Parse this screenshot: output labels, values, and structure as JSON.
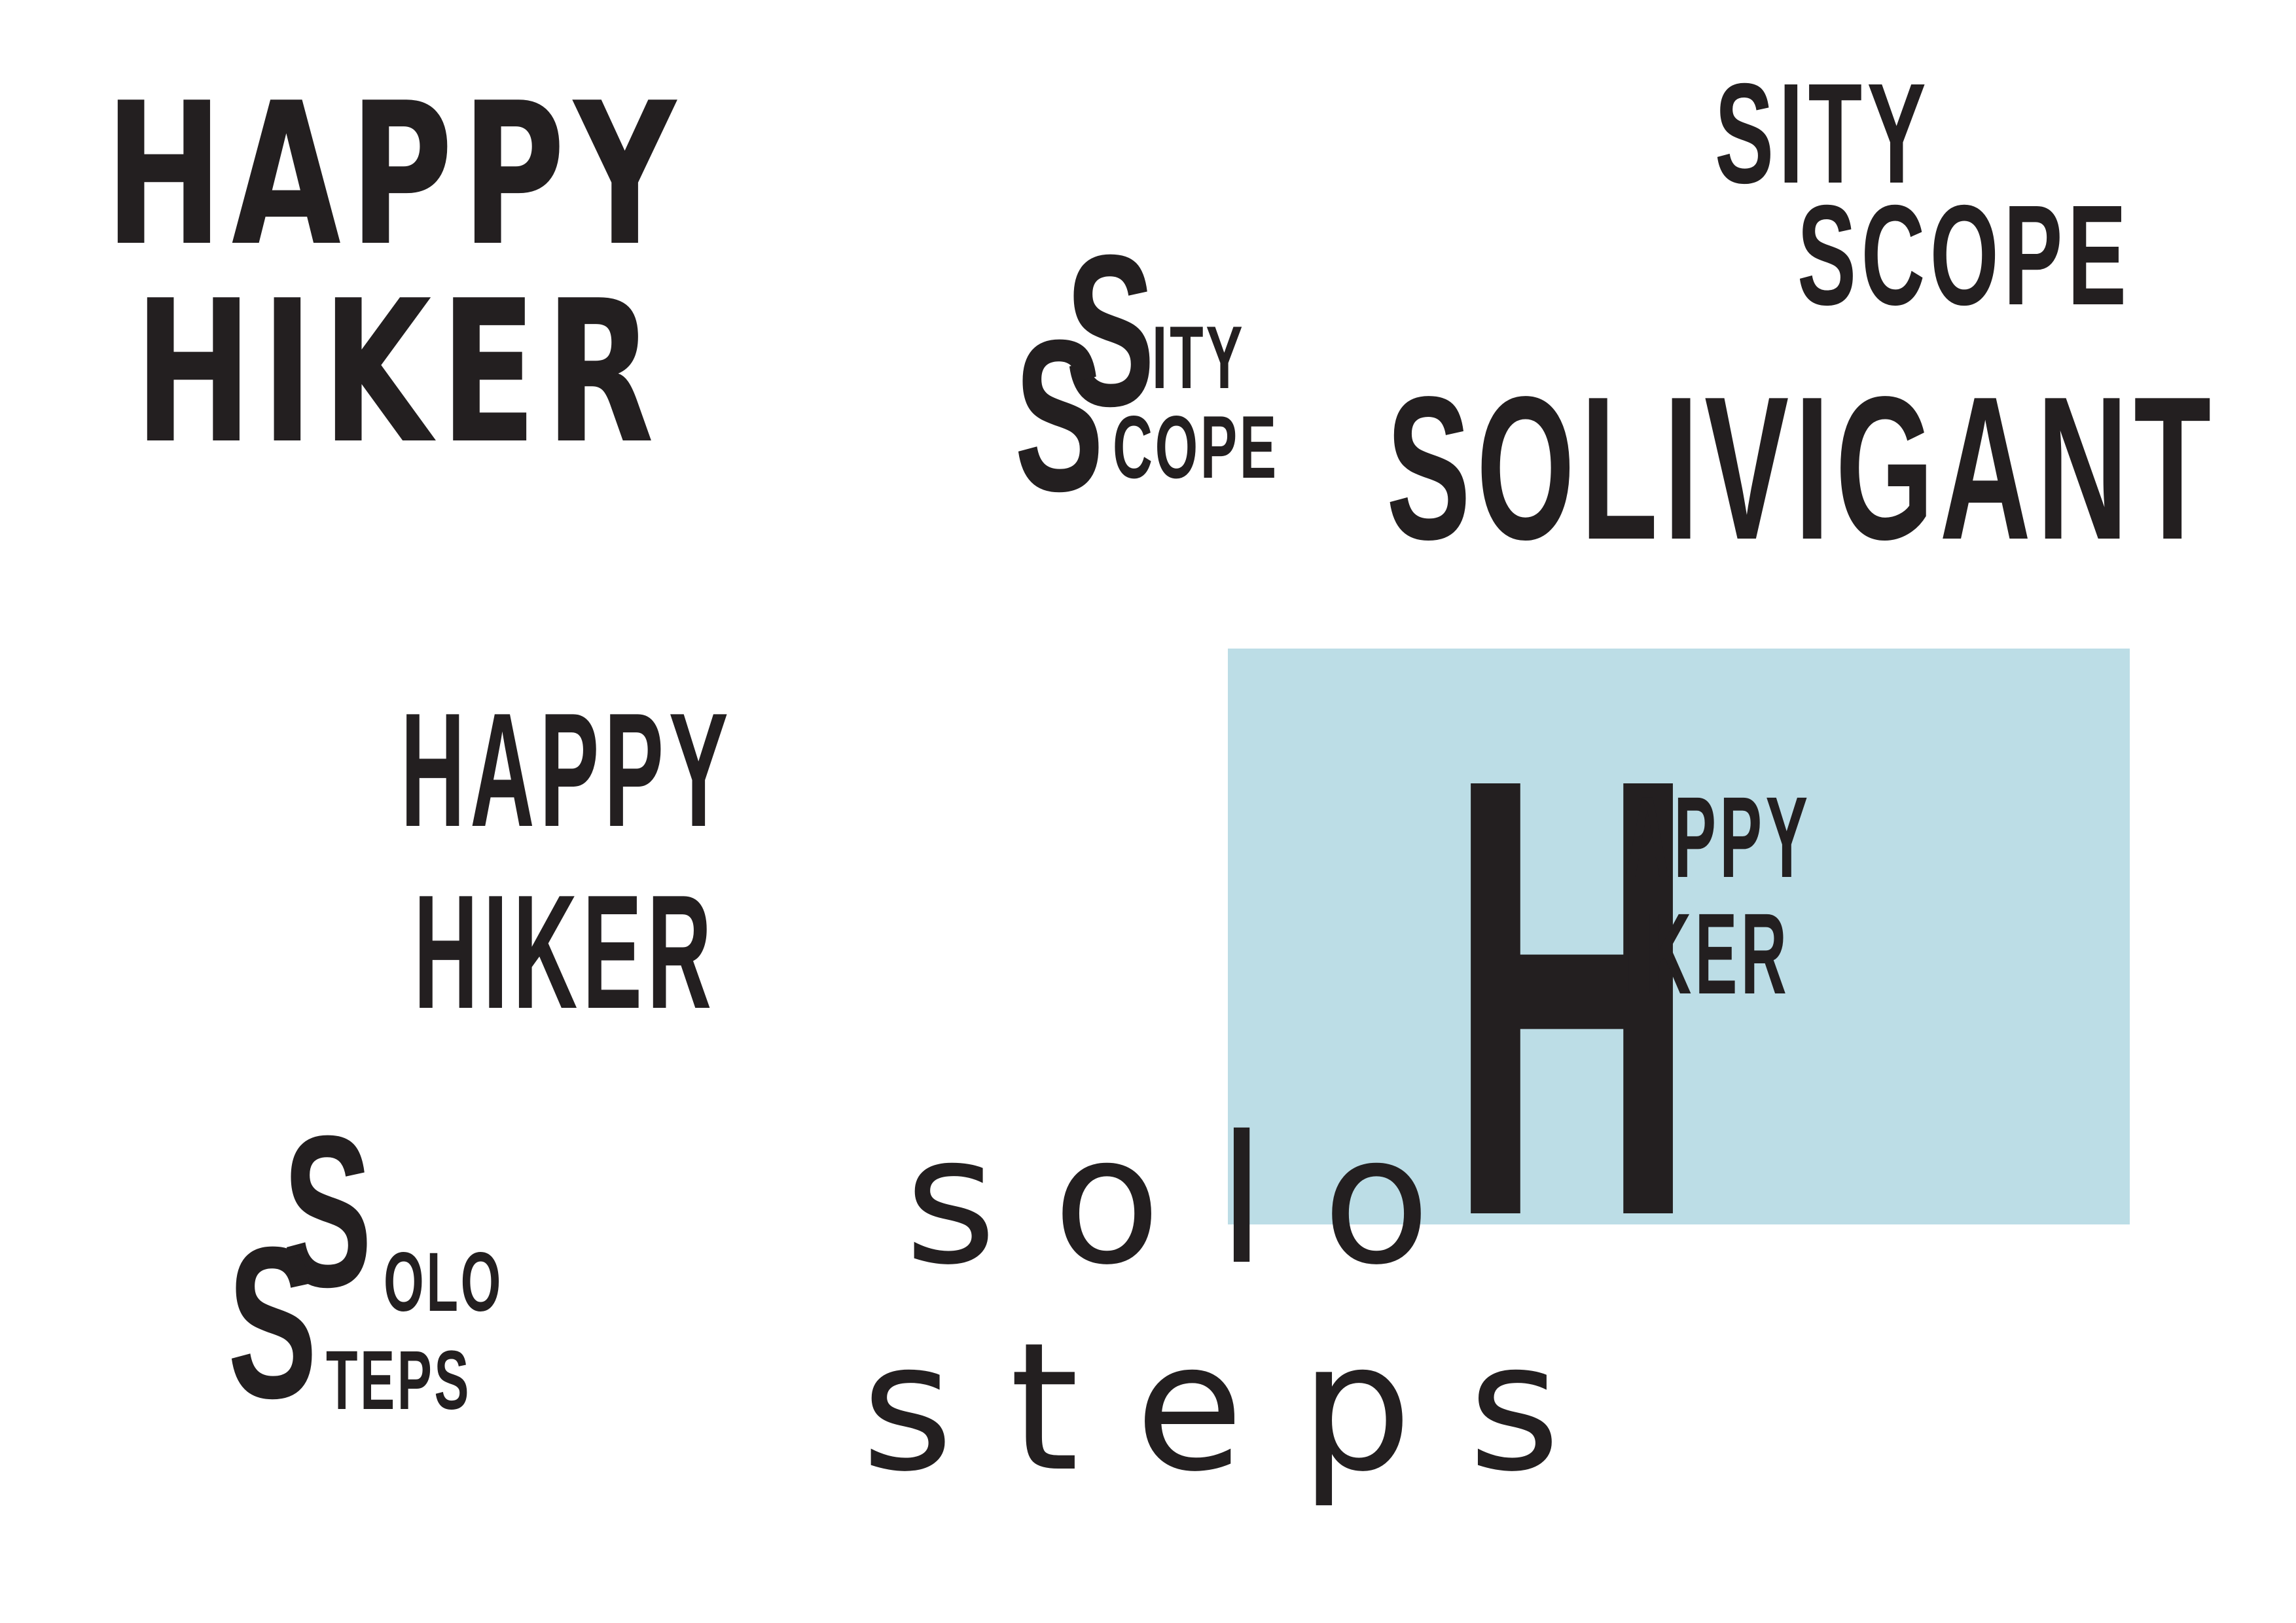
{
  "panel_color": "#bcdde6",
  "ink_color": "#231f20",
  "logos": {
    "bubble": {
      "line1": "HAPPY",
      "line2": "HIKER"
    },
    "stencil": {
      "line1": "HAPPY",
      "line2": "HIKER"
    },
    "panel_mark": {
      "big_initial": "H",
      "line1": "APPY",
      "line2": "IKER"
    },
    "sity_scope_stacked": {
      "initial_top": "S",
      "initial_bottom": "S",
      "line1": "ITY",
      "line2": "COPE"
    },
    "sity_scope": {
      "line1": "SITY",
      "line2": "SCOPE"
    },
    "solivigant": {
      "word": "SOLIVIGANT"
    },
    "solo_steps_stacked": {
      "initial_top": "S",
      "initial_bottom": "S",
      "line1": "OLO",
      "line2": "TEPS"
    },
    "solo_steps": {
      "line1": "s o l o",
      "line2": "s t e p s"
    }
  }
}
